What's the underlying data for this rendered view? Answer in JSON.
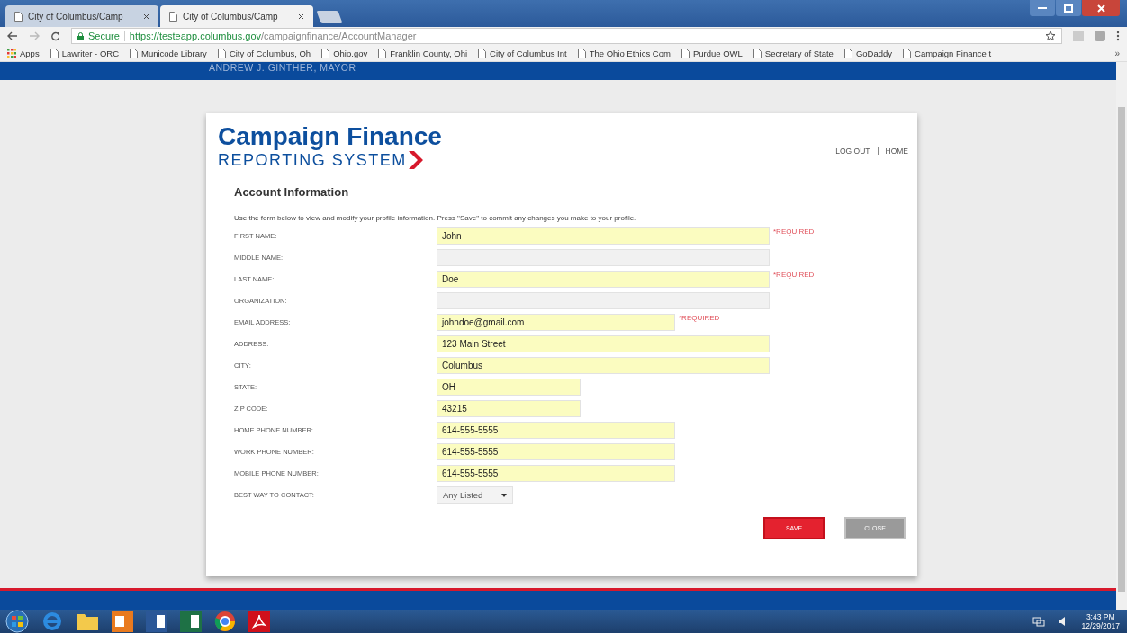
{
  "browser": {
    "tabs": [
      {
        "label": "City of Columbus/Camp",
        "selected": false
      },
      {
        "label": "City of Columbus/Camp",
        "selected": true
      }
    ],
    "address": {
      "secure_label": "Secure",
      "host": "https://testeapp.columbus.gov",
      "path": "/campaignfinance/AccountManager"
    },
    "bookmarks": [
      "Apps",
      "Lawriter - ORC",
      "Municode Library",
      "City of Columbus, Oh",
      "Ohio.gov",
      "Franklin County, Ohi",
      "City of Columbus Int",
      "The Ohio Ethics Com",
      "Purdue OWL",
      "Secretary of State",
      "GoDaddy",
      "Campaign Finance t"
    ],
    "bookmarks_more": "»"
  },
  "site_header": {
    "mayor": "ANDREW J. GINTHER, MAYOR"
  },
  "logo": {
    "line1": "Campaign Finance",
    "line2": "REPORTING SYSTEM"
  },
  "nav": [
    "LOG OUT",
    "HOME"
  ],
  "form": {
    "title": "Account Information",
    "intro": "Use the form below to view and modify your profile information. Press \"Save\" to commit any changes you make to your profile.",
    "fields": [
      {
        "label": "FIRST NAME:",
        "kind": "long",
        "value": "John",
        "required_note": "*REQUIRED"
      },
      {
        "label": "MIDDLE NAME:",
        "kind": "long"
      },
      {
        "label": "LAST NAME:",
        "kind": "long",
        "value": "Doe",
        "required_note": "*REQUIRED"
      },
      {
        "label": "ORGANIZATION:",
        "kind": "long"
      },
      {
        "label": "EMAIL ADDRESS:",
        "kind": "medium",
        "value": "johndoe@gmail.com",
        "required_note": "*REQUIRED"
      },
      {
        "label": "ADDRESS:",
        "kind": "long",
        "value": "123 Main Street"
      },
      {
        "label": "CITY:",
        "kind": "long",
        "value": "Columbus"
      },
      {
        "label": "STATE:",
        "kind": "short",
        "value": "OH"
      },
      {
        "label": "ZIP CODE:",
        "kind": "short",
        "value": "43215"
      },
      {
        "label": "HOME PHONE NUMBER:",
        "kind": "medium",
        "value": "614-555-5555"
      },
      {
        "label": "WORK PHONE NUMBER:",
        "kind": "medium",
        "value": "614-555-5555"
      },
      {
        "label": "MOBILE PHONE NUMBER:",
        "kind": "medium",
        "value": "614-555-5555"
      },
      {
        "label": "BEST WAY TO CONTACT:",
        "kind": "select",
        "value": "Any Listed"
      }
    ],
    "buttons": [
      {
        "label": "SAVE",
        "disabled": false
      },
      {
        "label": "CLOSE",
        "disabled": true
      }
    ]
  },
  "taskbar": {
    "time": "3:43 PM",
    "date": "12/29/2017"
  }
}
